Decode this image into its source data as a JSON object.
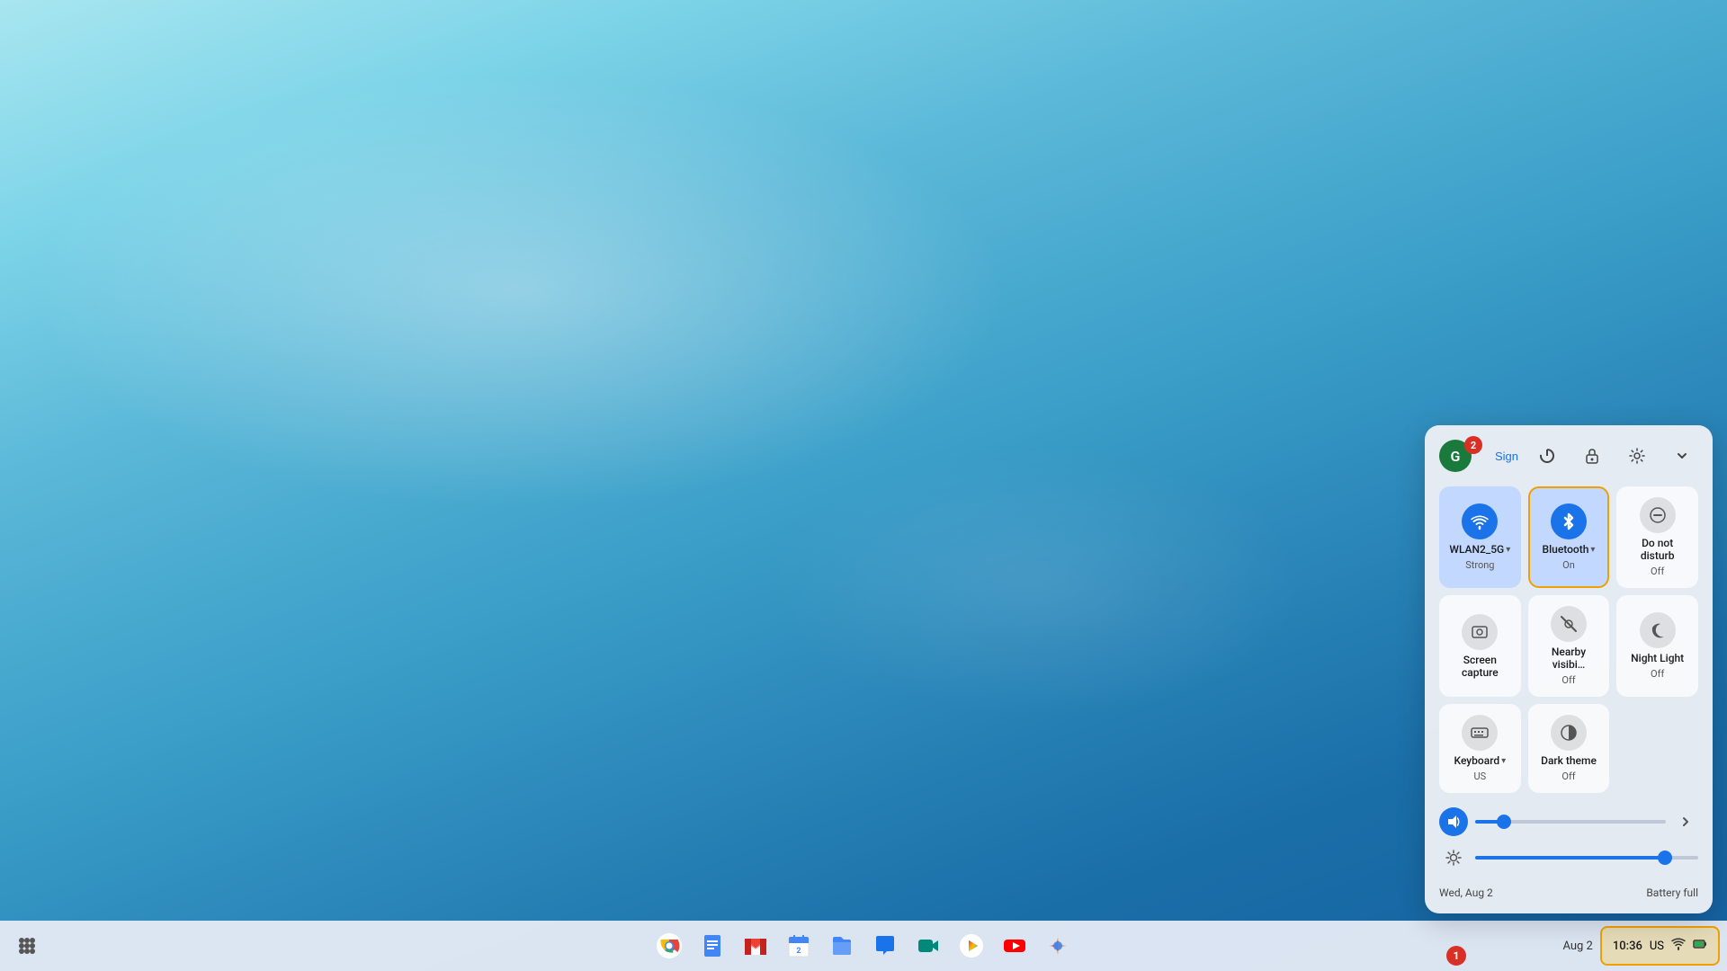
{
  "desktop": {
    "background": "ChromeOS blue gradient desktop"
  },
  "taskbar": {
    "apps": [
      {
        "name": "Chrome",
        "emoji": "🌐",
        "id": "chrome"
      },
      {
        "name": "Docs",
        "emoji": "📄",
        "id": "docs"
      },
      {
        "name": "Gmail",
        "emoji": "✉️",
        "id": "gmail"
      },
      {
        "name": "Calendar",
        "emoji": "📅",
        "id": "calendar"
      },
      {
        "name": "Files",
        "emoji": "📁",
        "id": "files"
      },
      {
        "name": "Messages",
        "emoji": "💬",
        "id": "messages"
      },
      {
        "name": "Meet",
        "emoji": "📹",
        "id": "meet"
      },
      {
        "name": "Play",
        "emoji": "▶️",
        "id": "play"
      },
      {
        "name": "YouTube",
        "emoji": "▶",
        "id": "youtube"
      },
      {
        "name": "Photos",
        "emoji": "🖼️",
        "id": "photos"
      }
    ],
    "tray": {
      "time": "10:36",
      "locale": "US",
      "wifi_icon": "📶",
      "battery_icon": "🔋"
    }
  },
  "quick_settings": {
    "header": {
      "avatar_letter": "G",
      "sign_label": "Sign",
      "notification_count": "2",
      "power_icon": "⏻",
      "lock_icon": "🔒",
      "settings_icon": "⚙",
      "collapse_icon": "∨"
    },
    "tiles": [
      {
        "id": "wifi",
        "icon": "wifi",
        "label": "WLAN2_5G",
        "has_dropdown": true,
        "sublabel": "Strong",
        "active": true
      },
      {
        "id": "bluetooth",
        "icon": "bluetooth",
        "label": "Bluetooth",
        "has_dropdown": true,
        "sublabel": "On",
        "active": true,
        "highlighted": true
      },
      {
        "id": "dnd",
        "icon": "dnd",
        "label": "Do not disturb",
        "sublabel": "Off",
        "active": false
      },
      {
        "id": "screencapture",
        "icon": "screencapture",
        "label": "Screen capture",
        "sublabel": "",
        "active": false
      },
      {
        "id": "nearbyvisibi",
        "icon": "nearby",
        "label": "Nearby visibi…",
        "sublabel": "Off",
        "active": false
      },
      {
        "id": "nightlight",
        "icon": "nightlight",
        "label": "Night Light",
        "sublabel": "Off",
        "active": false
      },
      {
        "id": "keyboard",
        "icon": "keyboard",
        "label": "Keyboard",
        "has_dropdown": true,
        "sublabel": "US",
        "active": false
      },
      {
        "id": "darktheme",
        "icon": "darktheme",
        "label": "Dark theme",
        "sublabel": "Off",
        "active": false
      }
    ],
    "volume": {
      "icon": "🔊",
      "value": 15,
      "max": 100
    },
    "brightness": {
      "icon": "☀",
      "value": 85,
      "max": 100
    },
    "footer": {
      "date": "Wed, Aug 2",
      "battery": "Battery full"
    }
  },
  "badge1": {
    "label": "1"
  }
}
